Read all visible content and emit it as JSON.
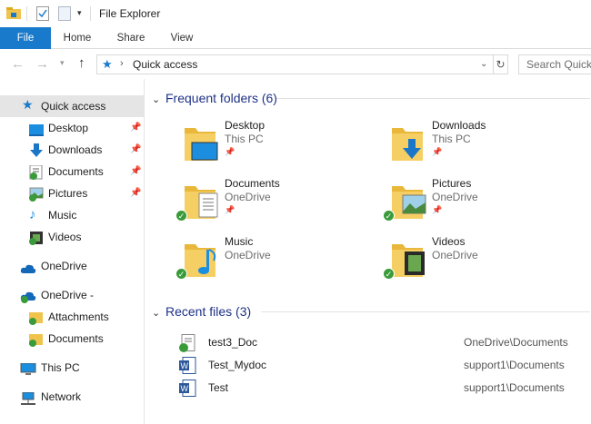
{
  "window": {
    "title": "File Explorer"
  },
  "ribbon": {
    "tabs": [
      "File",
      "Home",
      "Share",
      "View"
    ]
  },
  "address": {
    "location": "Quick access",
    "search_placeholder": "Search Quick access"
  },
  "sidebar": {
    "items": [
      {
        "label": "Quick access",
        "icon": "star-icon",
        "pinned": false
      },
      {
        "label": "Desktop",
        "icon": "desktop-icon",
        "pinned": true
      },
      {
        "label": "Downloads",
        "icon": "download-arrow-icon",
        "pinned": true
      },
      {
        "label": "Documents",
        "icon": "documents-icon",
        "pinned": true
      },
      {
        "label": "Pictures",
        "icon": "pictures-icon",
        "pinned": true
      },
      {
        "label": "Music",
        "icon": "music-note-icon",
        "pinned": false
      },
      {
        "label": "Videos",
        "icon": "video-film-icon",
        "pinned": false
      },
      {
        "label": "OneDrive",
        "icon": "cloud-icon",
        "pinned": false
      },
      {
        "label": "OneDrive -",
        "icon": "cloud-icon",
        "pinned": false
      },
      {
        "label": "Attachments",
        "icon": "folder-icon",
        "pinned": false
      },
      {
        "label": "Documents",
        "icon": "folder-icon",
        "pinned": false
      },
      {
        "label": "This PC",
        "icon": "computer-icon",
        "pinned": false
      },
      {
        "label": "Network",
        "icon": "network-icon",
        "pinned": false
      }
    ]
  },
  "frequent": {
    "heading": "Frequent folders (6)",
    "folders": [
      {
        "name": "Desktop",
        "location": "This PC",
        "pinned": true,
        "synced": false
      },
      {
        "name": "Downloads",
        "location": "This PC",
        "pinned": true,
        "synced": false
      },
      {
        "name": "Documents",
        "location": "OneDrive",
        "pinned": true,
        "synced": true
      },
      {
        "name": "Pictures",
        "location": "OneDrive",
        "pinned": true,
        "synced": true
      },
      {
        "name": "Music",
        "location": "OneDrive",
        "pinned": false,
        "synced": true
      },
      {
        "name": "Videos",
        "location": "OneDrive",
        "pinned": false,
        "synced": true
      }
    ]
  },
  "recent": {
    "heading": "Recent files (3)",
    "files": [
      {
        "name": "test3_Doc",
        "location": "OneDrive\\Documents",
        "icon": "text-document-icon"
      },
      {
        "name": "Test_Mydoc",
        "location": "support1\\Documents",
        "icon": "word-document-icon"
      },
      {
        "name": "Test",
        "location": "support1\\Documents",
        "icon": "word-document-icon"
      }
    ]
  },
  "colors": {
    "accent": "#1979ca",
    "folder": "#f0c44c",
    "sync_check": "#3a9b3a"
  }
}
